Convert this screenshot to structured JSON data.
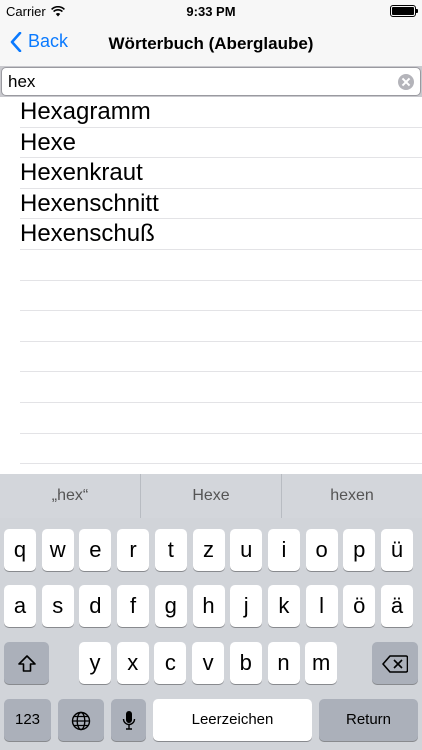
{
  "status": {
    "carrier": "Carrier",
    "time": "9:33 PM"
  },
  "nav": {
    "back_label": "Back",
    "title": "Wörterbuch (Aberglaube)"
  },
  "search": {
    "value": "hex"
  },
  "results": [
    "Hexagramm",
    "Hexe",
    "Hexenkraut",
    "Hexenschnitt",
    "Hexenschuß"
  ],
  "suggestions": [
    "„hex“",
    "Hexe",
    "hexen"
  ],
  "keyboard": {
    "row1": [
      "q",
      "w",
      "e",
      "r",
      "t",
      "z",
      "u",
      "i",
      "o",
      "p",
      "ü"
    ],
    "row2": [
      "a",
      "s",
      "d",
      "f",
      "g",
      "h",
      "j",
      "k",
      "l",
      "ö",
      "ä"
    ],
    "row3": [
      "y",
      "x",
      "c",
      "v",
      "b",
      "n",
      "m"
    ],
    "numbers_label": "123",
    "space_label": "Leerzeichen",
    "return_label": "Return"
  },
  "colors": {
    "accent": "#0a7aff",
    "keyboard_bg": "#d1d4d9",
    "func_key": "#abb0ba"
  },
  "icons": {
    "back": "chevron-left-icon",
    "wifi": "wifi-icon",
    "clear": "clear-icon",
    "shift": "shift-icon",
    "globe": "globe-icon",
    "mic": "microphone-icon",
    "delete": "backspace-icon"
  }
}
